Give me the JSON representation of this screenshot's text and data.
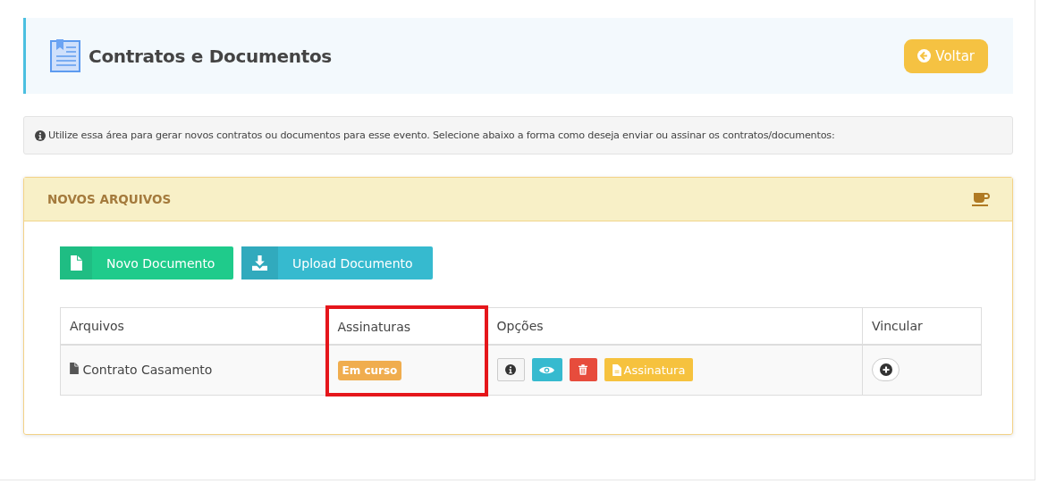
{
  "header": {
    "title": "Contratos e Documentos",
    "back_button": "Voltar"
  },
  "info": "Utilize essa área para gerar novos contratos ou documentos para esse evento. Selecione abaixo a forma como deseja enviar ou assinar os contratos/documentos:",
  "panel": {
    "title": "NOVOS ARQUIVOS",
    "actions": [
      {
        "label": "Novo Documento",
        "kind": "new"
      },
      {
        "label": "Upload Documento",
        "kind": "upload"
      }
    ],
    "table": {
      "columns": [
        {
          "label": "Arquivos",
          "highlighted": false
        },
        {
          "label": "Assinaturas",
          "highlighted": true
        },
        {
          "label": "Opções",
          "highlighted": false
        },
        {
          "label": "Vincular",
          "highlighted": false
        }
      ],
      "rows": [
        {
          "file": "Contrato Casamento",
          "status": "Em curso",
          "options": [
            {
              "kind": "info"
            },
            {
              "kind": "view"
            },
            {
              "kind": "delete"
            },
            {
              "kind": "sign",
              "label": "Assinatura"
            }
          ]
        }
      ]
    }
  }
}
